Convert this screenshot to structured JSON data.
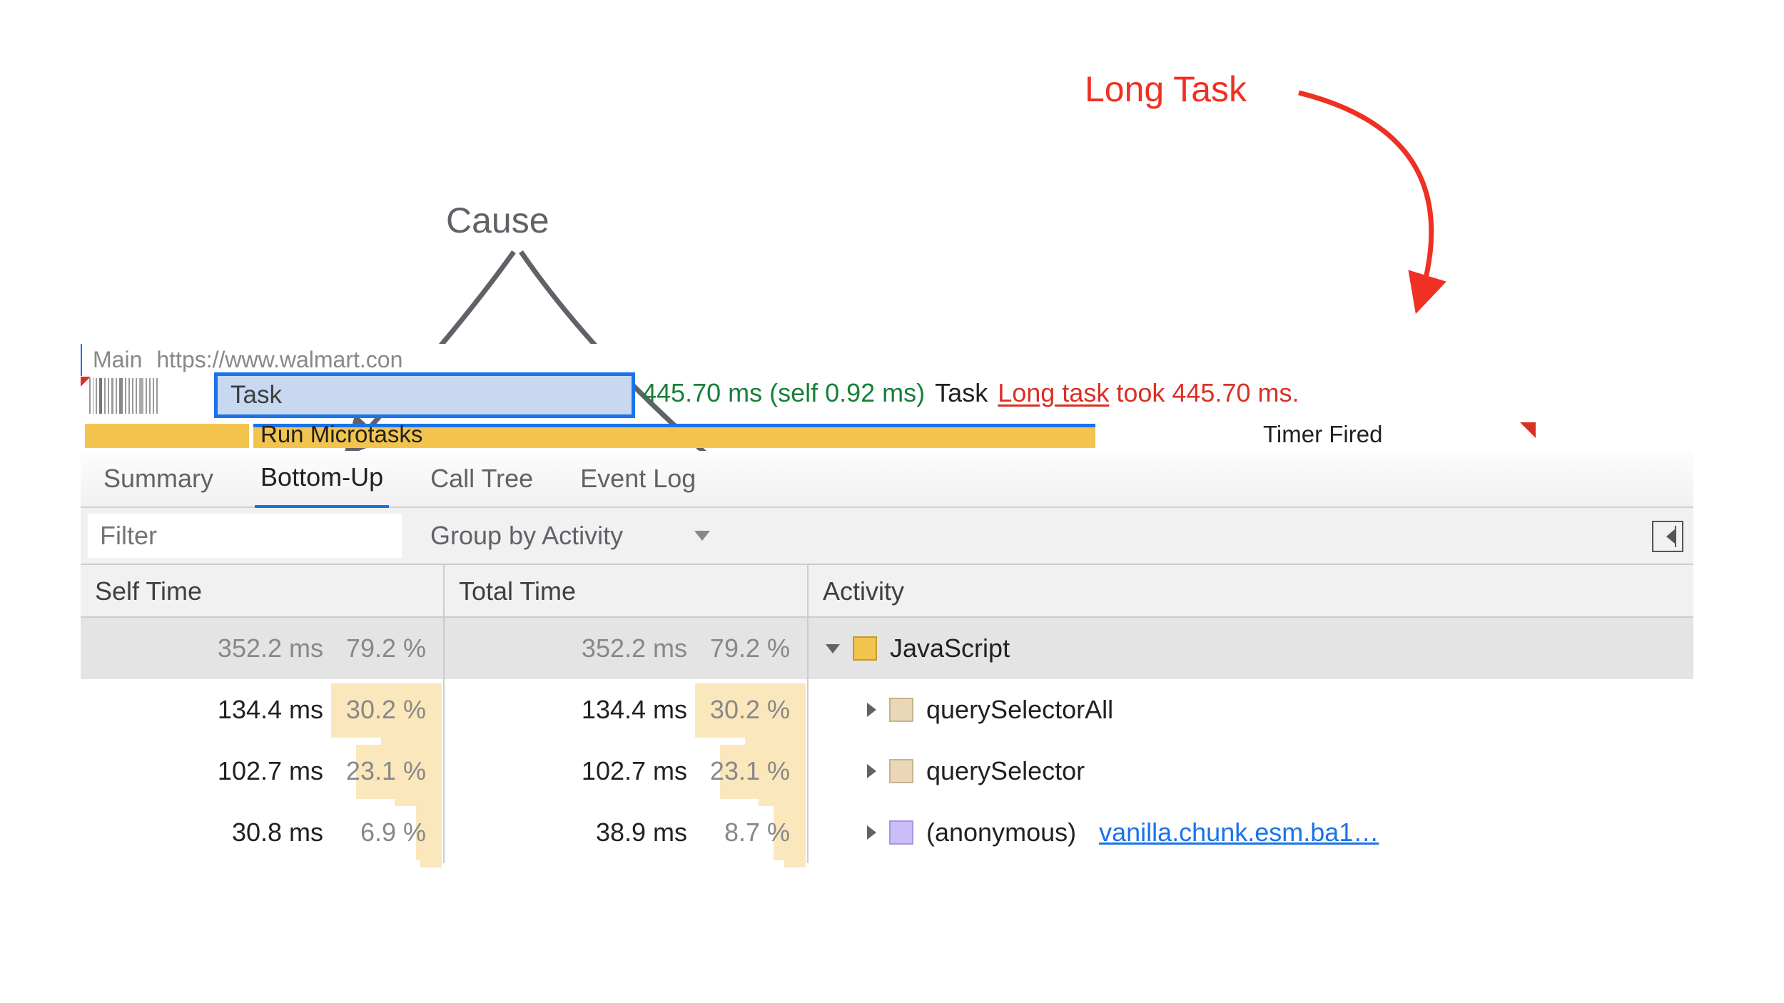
{
  "annotations": {
    "long_task": "Long Task",
    "cause": "Cause"
  },
  "flame": {
    "main_label": "Main",
    "url_partial": "https://www.walmart.con",
    "task_label": "Task",
    "task_time": "445.70 ms (self 0.92 ms)",
    "task_word": "Task",
    "long_task_link": "Long task",
    "long_task_rest": " took 445.70 ms.",
    "micro_label": "Run Microtasks",
    "timer_label": "Timer Fired"
  },
  "tabs": {
    "summary": "Summary",
    "bottom_up": "Bottom-Up",
    "call_tree": "Call Tree",
    "event_log": "Event Log"
  },
  "filter": {
    "placeholder": "Filter",
    "group_by": "Group by Activity"
  },
  "columns": {
    "self": "Self Time",
    "total": "Total Time",
    "activity": "Activity"
  },
  "rows": [
    {
      "self_ms": "352.2 ms",
      "self_pct": "79.2 %",
      "self_bar_w": 0,
      "total_ms": "352.2 ms",
      "total_pct": "79.2 %",
      "total_bar_w": 0,
      "icon": "down",
      "swatch": "yellow",
      "name": "JavaScript",
      "indent": 0,
      "link": "",
      "selected": true,
      "grey_ms": true
    },
    {
      "self_ms": "134.4 ms",
      "self_pct": "30.2 %",
      "self_bar_w": 155,
      "total_ms": "134.4 ms",
      "total_pct": "30.2 %",
      "total_bar_w": 155,
      "icon": "right",
      "swatch": "tan",
      "name": "querySelectorAll",
      "indent": 1,
      "link": ""
    },
    {
      "self_ms": "102.7 ms",
      "self_pct": "23.1 %",
      "self_bar_w": 120,
      "total_ms": "102.7 ms",
      "total_pct": "23.1 %",
      "total_bar_w": 120,
      "icon": "right",
      "swatch": "tan",
      "name": "querySelector",
      "indent": 1,
      "link": ""
    },
    {
      "self_ms": "30.8 ms",
      "self_pct": "6.9 %",
      "self_bar_w": 36,
      "total_ms": "38.9 ms",
      "total_pct": "8.7 %",
      "total_bar_w": 45,
      "icon": "right",
      "swatch": "purple",
      "name": "(anonymous)",
      "indent": 1,
      "link": "vanilla.chunk.esm.ba1…"
    }
  ]
}
